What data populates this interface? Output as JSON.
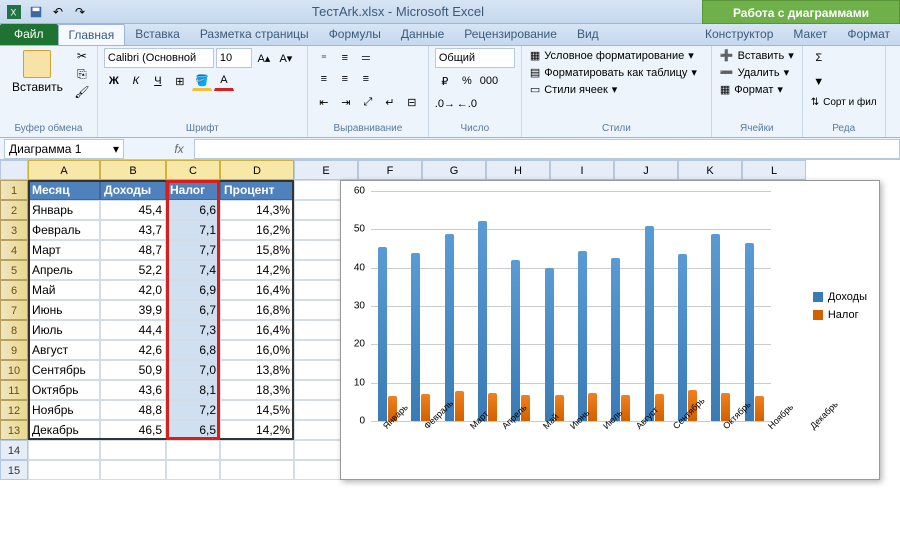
{
  "app": {
    "title": "ТестArk.xlsx - Microsoft Excel",
    "chart_tools_label": "Работа с диаграммами"
  },
  "tabs": {
    "file": "Файл",
    "items": [
      "Главная",
      "Вставка",
      "Разметка страницы",
      "Формулы",
      "Данные",
      "Рецензирование",
      "Вид"
    ],
    "chart_tabs": [
      "Конструктор",
      "Макет",
      "Формат"
    ]
  },
  "ribbon": {
    "clipboard": {
      "label": "Буфер обмена",
      "paste": "Вставить"
    },
    "font": {
      "label": "Шрифт",
      "name": "Calibri (Основной",
      "size": "10"
    },
    "alignment": {
      "label": "Выравнивание"
    },
    "number": {
      "label": "Число",
      "format": "Общий"
    },
    "styles": {
      "label": "Стили",
      "conditional": "Условное форматирование",
      "table": "Форматировать как таблицу",
      "cell": "Стили ячеек"
    },
    "cells": {
      "label": "Ячейки",
      "insert": "Вставить",
      "delete": "Удалить",
      "format": "Формат"
    },
    "editing": {
      "label": "Реда",
      "sort": "Сорт и фил"
    }
  },
  "name_box": "Диаграмма 1",
  "fx_label": "fx",
  "columns": [
    "A",
    "B",
    "C",
    "D",
    "E",
    "F",
    "G",
    "H",
    "I",
    "J",
    "K",
    "L"
  ],
  "table_headers": [
    "Месяц",
    "Доходы",
    "Налог",
    "Процент"
  ],
  "rows": [
    {
      "m": "Январь",
      "d": "45,4",
      "n": "6,6",
      "p": "14,3%"
    },
    {
      "m": "Февраль",
      "d": "43,7",
      "n": "7,1",
      "p": "16,2%"
    },
    {
      "m": "Март",
      "d": "48,7",
      "n": "7,7",
      "p": "15,8%"
    },
    {
      "m": "Апрель",
      "d": "52,2",
      "n": "7,4",
      "p": "14,2%"
    },
    {
      "m": "Май",
      "d": "42,0",
      "n": "6,9",
      "p": "16,4%"
    },
    {
      "m": "Июнь",
      "d": "39,9",
      "n": "6,7",
      "p": "16,8%"
    },
    {
      "m": "Июль",
      "d": "44,4",
      "n": "7,3",
      "p": "16,4%"
    },
    {
      "m": "Август",
      "d": "42,6",
      "n": "6,8",
      "p": "16,0%"
    },
    {
      "m": "Сентябрь",
      "d": "50,9",
      "n": "7,0",
      "p": "13,8%"
    },
    {
      "m": "Октябрь",
      "d": "43,6",
      "n": "8,1",
      "p": "18,3%"
    },
    {
      "m": "Ноябрь",
      "d": "48,8",
      "n": "7,2",
      "p": "14,5%"
    },
    {
      "m": "Декабрь",
      "d": "46,5",
      "n": "6,5",
      "p": "14,2%"
    }
  ],
  "legend": {
    "s1": "Доходы",
    "s2": "Налог"
  },
  "chart_data": {
    "type": "bar",
    "categories": [
      "Январь",
      "Февраль",
      "Март",
      "Апрель",
      "Май",
      "Июнь",
      "Июль",
      "Август",
      "Сентябрь",
      "Октябрь",
      "Ноябрь",
      "Декабрь"
    ],
    "series": [
      {
        "name": "Доходы",
        "values": [
          45.4,
          43.7,
          48.7,
          52.2,
          42.0,
          39.9,
          44.4,
          42.6,
          50.9,
          43.6,
          48.8,
          46.5
        ]
      },
      {
        "name": "Налог",
        "values": [
          6.6,
          7.1,
          7.7,
          7.4,
          6.9,
          6.7,
          7.3,
          6.8,
          7.0,
          8.1,
          7.2,
          6.5
        ]
      }
    ],
    "ylim": [
      0,
      60
    ],
    "y_ticks": [
      0,
      10,
      20,
      30,
      40,
      50,
      60
    ],
    "xlabel": "",
    "ylabel": "",
    "title": ""
  }
}
